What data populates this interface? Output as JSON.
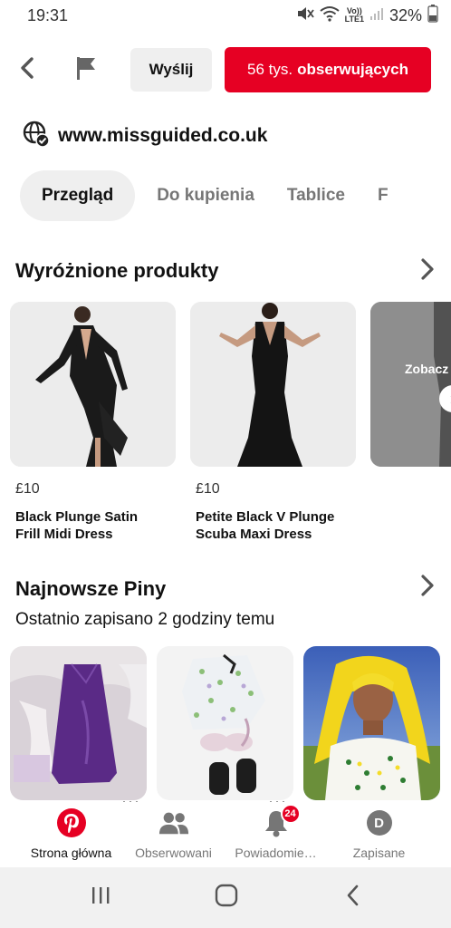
{
  "status": {
    "time": "19:31",
    "network_top": "Vo))",
    "network_bottom": "LTE1",
    "battery": "32%"
  },
  "header": {
    "back_icon": "chevron-left-icon",
    "flag_icon": "flag-icon",
    "send_label": "Wyślij",
    "followers_count": "56 tys.",
    "followers_word": "obserwujących"
  },
  "profile": {
    "site_icon": "verified-globe-icon",
    "url": "www.missguided.co.uk"
  },
  "tabs": [
    {
      "label": "Przegląd",
      "active": true
    },
    {
      "label": "Do kupienia",
      "active": false
    },
    {
      "label": "Tablice",
      "active": false
    },
    {
      "label": "F",
      "active": false
    }
  ],
  "featured": {
    "title": "Wyróżnione produkty",
    "products": [
      {
        "price": "£10",
        "name_line1": "Black Plunge Satin",
        "name_line2": "Frill Midi Dress"
      },
      {
        "price": "£10",
        "name_line1": "Petite Black V Plunge",
        "name_line2": "Scuba Maxi Dress"
      }
    ],
    "see_more": "Zobacz"
  },
  "latest": {
    "title": "Najnowsze Piny",
    "subtitle": "Ostatnio zapisano 2 godziny temu"
  },
  "bottom_nav": [
    {
      "label": "Strona główna",
      "icon": "pinterest-logo-icon",
      "active": true
    },
    {
      "label": "Obserwowani",
      "icon": "people-icon",
      "active": false
    },
    {
      "label": "Powiadomie…",
      "icon": "bell-icon",
      "active": false,
      "badge": "24"
    },
    {
      "label": "Zapisane",
      "icon": "avatar-icon",
      "active": false,
      "avatar_letter": "D"
    }
  ],
  "colors": {
    "brand_red": "#e60023",
    "chip_gray": "#efefef",
    "muted_text": "#767676"
  }
}
